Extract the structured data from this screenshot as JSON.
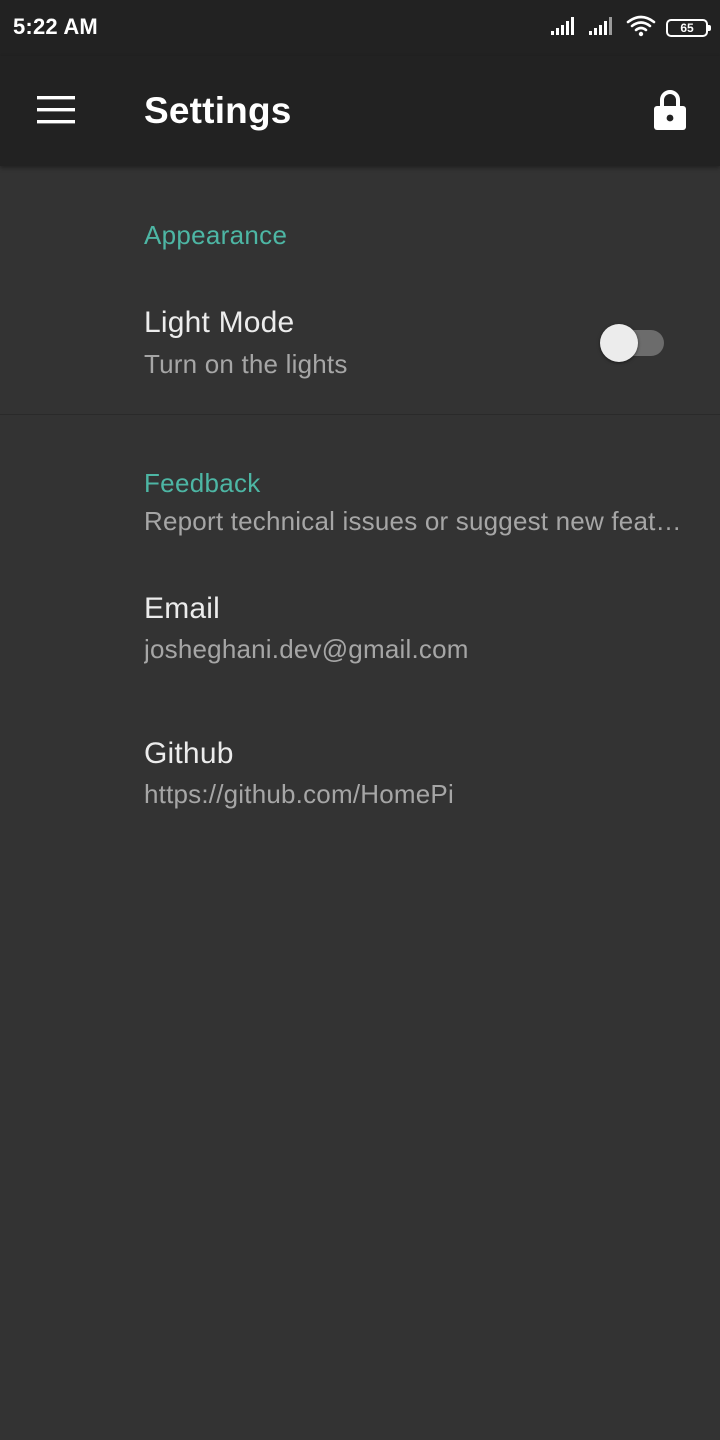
{
  "status_bar": {
    "time": "5:22 AM",
    "battery": "65",
    "icons": [
      "signal-icon",
      "signal-icon",
      "wifi-icon",
      "battery-icon"
    ]
  },
  "app_bar": {
    "title": "Settings",
    "menu_icon": "hamburger-menu-icon",
    "action_icon": "lock-icon"
  },
  "sections": {
    "appearance": {
      "header": "Appearance",
      "light_mode": {
        "title": "Light Mode",
        "summary": "Turn on the lights",
        "enabled": false
      }
    },
    "feedback": {
      "header": "Feedback",
      "summary": "Report technical issues or suggest new features",
      "email": {
        "title": "Email",
        "summary": "josheghani.dev@gmail.com"
      },
      "github": {
        "title": "Github",
        "summary": "https://github.com/HomePi"
      }
    }
  },
  "colors": {
    "background": "#333333",
    "app_bar": "#222222",
    "accent": "#4db6a4",
    "primary_text": "#ececec",
    "secondary_text": "#a6a6a6"
  }
}
